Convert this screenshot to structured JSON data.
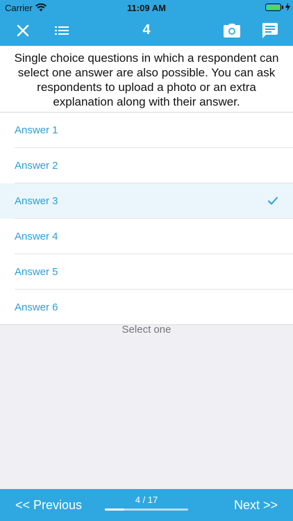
{
  "status_bar": {
    "carrier": "Carrier",
    "time": "11:09 AM"
  },
  "nav": {
    "title": "4",
    "icons": [
      "close-icon",
      "list-icon",
      "camera-icon",
      "comment-icon"
    ]
  },
  "question": {
    "text": "Single choice questions in which a respondent can select one answer are also possible. You can ask respondents to upload a photo or an extra explanation along with their answer."
  },
  "answers": [
    {
      "label": "Answer 1",
      "selected": false
    },
    {
      "label": "Answer 2",
      "selected": false
    },
    {
      "label": "Answer 3",
      "selected": true
    },
    {
      "label": "Answer 4",
      "selected": false
    },
    {
      "label": "Answer 5",
      "selected": false
    },
    {
      "label": "Answer 6",
      "selected": false
    }
  ],
  "hint": "Select one",
  "footer": {
    "previous_label": "<< Previous",
    "next_label": "Next >>",
    "progress_label": "4 / 17",
    "progress_fraction": 0.235
  },
  "colors": {
    "accent": "#2fa8e1",
    "answer_text": "#2a9fd6",
    "selected_row": "#eaf6fc",
    "battery": "#4cd964"
  }
}
